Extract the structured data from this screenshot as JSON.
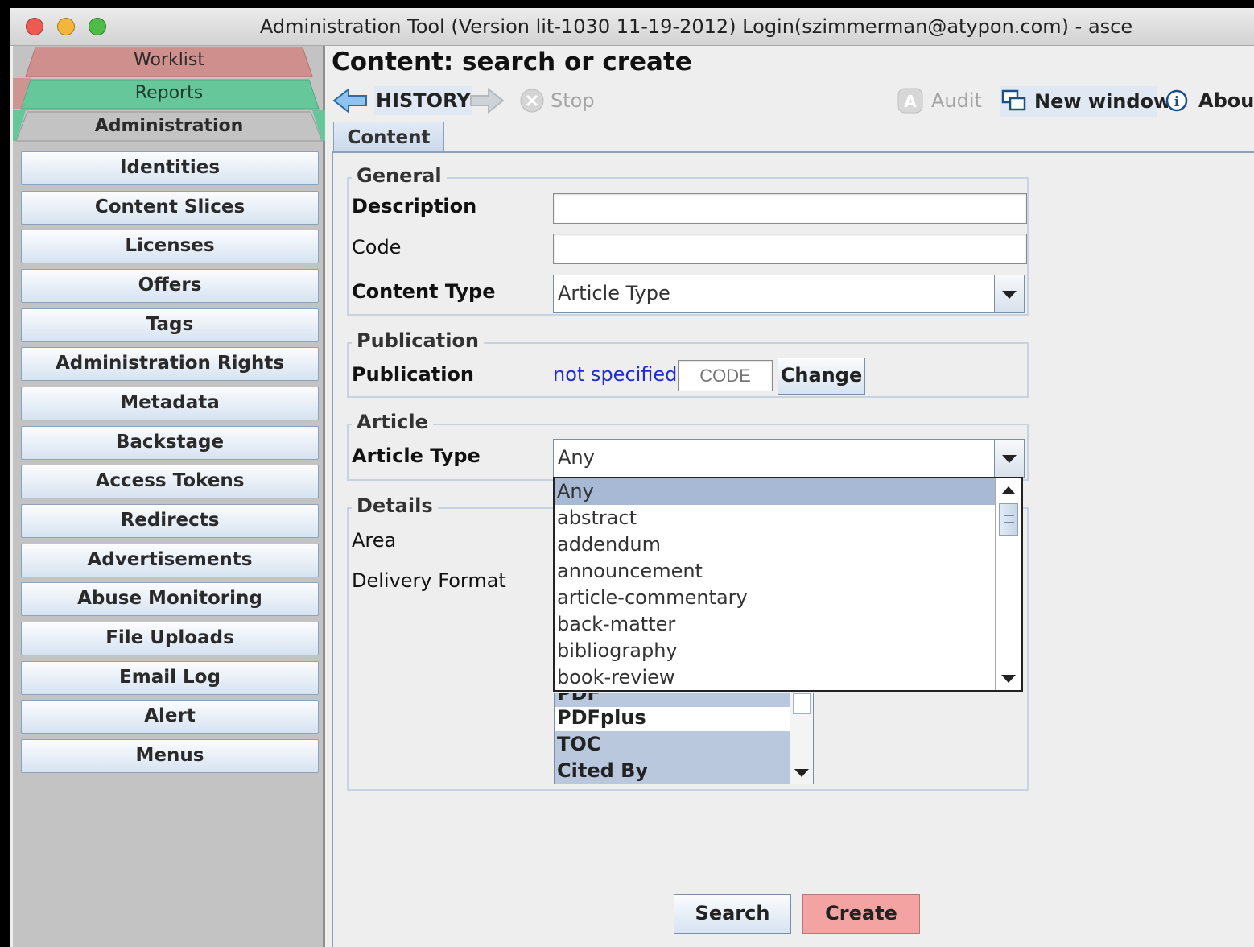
{
  "window": {
    "title": "Administration Tool (Version lit-1030 11-19-2012) Login(szimmerman@atypon.com) - asce"
  },
  "sidebar": {
    "tabs": [
      {
        "label": "Worklist",
        "color": "#cf8f8c"
      },
      {
        "label": "Reports",
        "color": "#66c79a"
      },
      {
        "label": "Administration",
        "color": "#c3c3c3"
      }
    ],
    "items": [
      {
        "label": "Identities"
      },
      {
        "label": "Content Slices"
      },
      {
        "label": "Licenses"
      },
      {
        "label": "Offers"
      },
      {
        "label": "Tags"
      },
      {
        "label": "Administration Rights"
      },
      {
        "label": "Metadata"
      },
      {
        "label": "Backstage"
      },
      {
        "label": "Access Tokens"
      },
      {
        "label": "Redirects"
      },
      {
        "label": "Advertisements"
      },
      {
        "label": "Abuse Monitoring"
      },
      {
        "label": "File Uploads"
      },
      {
        "label": "Email Log"
      },
      {
        "label": "Alert"
      },
      {
        "label": "Menus"
      }
    ]
  },
  "main": {
    "title": "Content: search or create",
    "toolbar": {
      "history": "HISTORY",
      "stop": "Stop",
      "audit": "Audit",
      "new_window": "New window",
      "about": "About"
    },
    "tab": "Content"
  },
  "general": {
    "legend": "General",
    "description_label": "Description",
    "description_value": "",
    "code_label": "Code",
    "code_value": "",
    "content_type_label": "Content Type",
    "content_type_value": "Article Type"
  },
  "publication": {
    "legend": "Publication",
    "label": "Publication",
    "value": "not specified",
    "code_placeholder": "CODE",
    "change_button": "Change"
  },
  "article": {
    "legend": "Article",
    "type_label": "Article Type",
    "type_value": "Any",
    "options": [
      "Any",
      "abstract",
      "addendum",
      "announcement",
      "article-commentary",
      "back-matter",
      "bibliography",
      "book-review"
    ],
    "selected_index": 0
  },
  "details": {
    "legend": "Details",
    "area_label": "Area",
    "delivery_label": "Delivery Format",
    "formats": [
      {
        "label": "PDF",
        "selected": true
      },
      {
        "label": "PDFplus",
        "selected": false
      },
      {
        "label": "TOC",
        "selected": true
      },
      {
        "label": "Cited By",
        "selected": true
      }
    ]
  },
  "actions": {
    "search": "Search",
    "create": "Create"
  },
  "colors": {
    "link": "#1f2bd6",
    "create_button": "#f4a3a3",
    "selection": "#a7b9d4"
  }
}
